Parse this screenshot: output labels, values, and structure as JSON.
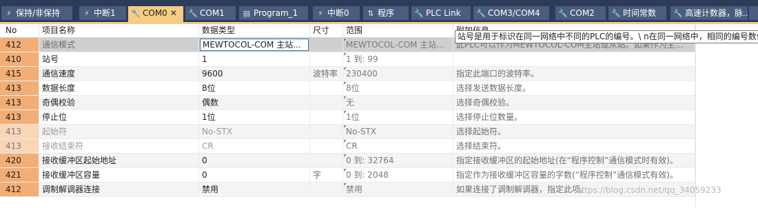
{
  "tabs": [
    {
      "label": "保持/非保持",
      "icon": "lightning-icon",
      "glyph": "⚡",
      "active": false
    },
    {
      "label": "中断1",
      "icon": "lightning-icon",
      "glyph": "⚡",
      "active": false
    },
    {
      "label": "COM0",
      "icon": "wrench-icon",
      "glyph": "🔧",
      "active": true,
      "close": "✕"
    },
    {
      "label": "COM1",
      "icon": "wrench-icon",
      "glyph": "🔧",
      "active": false
    },
    {
      "label": "Program_1",
      "icon": "document-icon",
      "glyph": "▤",
      "active": false
    },
    {
      "label": "中断0",
      "icon": "lightning-icon",
      "glyph": "⚡",
      "active": false
    },
    {
      "label": "程序",
      "icon": "program-icon",
      "glyph": "⇅",
      "active": false
    },
    {
      "label": "PLC Link",
      "icon": "wrench-icon",
      "glyph": "🔧",
      "active": false
    },
    {
      "label": "COM3/COM4",
      "icon": "wrench-icon",
      "glyph": "🔧",
      "active": false
    },
    {
      "label": "COM2",
      "icon": "wrench-icon",
      "glyph": "🔧",
      "active": false
    },
    {
      "label": "时间常数",
      "icon": "wrench-icon",
      "glyph": "🔧",
      "active": false
    },
    {
      "label": "高速计数器，脉...",
      "icon": "wrench-icon",
      "glyph": "🔧",
      "active": false
    }
  ],
  "columns": {
    "no": "No",
    "name": "项目名称",
    "value": "数据类型",
    "unit": "尺寸",
    "range": "范围",
    "info": "附加信息"
  },
  "rows": [
    {
      "no": "412",
      "name": "通信模式",
      "value": "MEWTOCOL-COM 主站...",
      "unit": "",
      "range": "MEWTOCOL-COM 主站...",
      "info": "此PLC可以作为MEWTOCOL-COM主站或从站。如果作为主..."
    },
    {
      "no": "410",
      "name": "站号",
      "value": "1",
      "unit": "",
      "range": "1 到: 99",
      "info": ""
    },
    {
      "no": "415",
      "name": "通信速度",
      "value": "9600",
      "unit": "波特率",
      "range": "230400",
      "info": "指定此端口的波特率。"
    },
    {
      "no": "413",
      "name": "数据长度",
      "value": "8位",
      "unit": "",
      "range": "8位",
      "info": "选择发送数据长度。"
    },
    {
      "no": "413",
      "name": "奇偶校验",
      "value": "偶数",
      "unit": "",
      "range": "无",
      "info": "选择奇偶校验。"
    },
    {
      "no": "413",
      "name": "停止位",
      "value": "1位",
      "unit": "",
      "range": "1位",
      "info": "选择停止位数量。"
    },
    {
      "no": "413",
      "name": "起始符",
      "value": "No-STX",
      "unit": "",
      "range": "No-STX",
      "info": "选择起始符。"
    },
    {
      "no": "413",
      "name": "接收结束符",
      "value": "CR",
      "unit": "",
      "range": "CR",
      "info": "选择结束符。"
    },
    {
      "no": "420",
      "name": "接收缓冲区起始地址",
      "value": "0",
      "unit": "",
      "range": "0 到: 32764",
      "info": "指定接收缓冲区的起始地址(在“程序控制”通信模式时有效)。"
    },
    {
      "no": "421",
      "name": "接收缓冲区容量",
      "value": "0",
      "unit": "字",
      "range": "0 到: 2048",
      "info": "指定作为接收缓冲区容量的字数(“程序控制”通信模式有效)。"
    },
    {
      "no": "412",
      "name": "调制解调器连接",
      "value": "禁用",
      "unit": "",
      "range": "禁用",
      "info": "如果连接了调制解调器，指定此项。"
    }
  ],
  "tooltip": "站号是用于标识在同一网络中不同的PLC的编号。\\ n在同一网络中，相同的编号数值",
  "watermark": "https://blog.csdn.net/qq_34059233",
  "colors": {
    "tabbar": "#2b3b58",
    "tab": "#4a5d7e",
    "active_tab": "#f5cc84",
    "no_cell": "#f2ae76",
    "no_cell_disabled": "#f9d6b6",
    "selection_border": "#2f6fb3"
  }
}
